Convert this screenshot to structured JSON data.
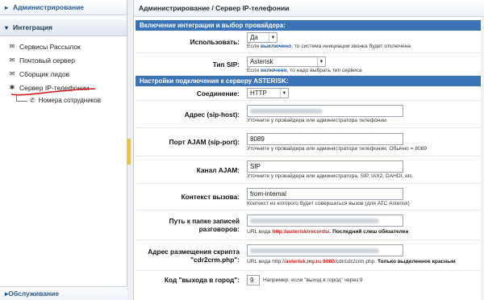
{
  "sidebar": {
    "admin_title": "Администрирование",
    "integration_title": "Интеграция",
    "items": [
      {
        "label": "Сервисы Рассылок",
        "icon": "envelope-icon"
      },
      {
        "label": "Почтовый сервер",
        "icon": "envelope-icon"
      },
      {
        "label": "Сборщик лидов",
        "icon": "envelope-icon"
      },
      {
        "label": "Сервер IP-телефонии",
        "icon": "gear-icon"
      }
    ],
    "sub_item": {
      "label": "Номера сотрудников",
      "icon": "phone-icon"
    },
    "footer": "Обслуживание"
  },
  "main": {
    "breadcrumb": "Администрирование / Сервер IP-телефонии",
    "section1": {
      "title": "Включение интеграции и выбор провайдера:",
      "use_label": "Использовать:",
      "use_value": "Да",
      "use_hint_pre": "Если ",
      "use_hint_kw": "выключено",
      "use_hint_post": ", то система инициации звонка будет отключена",
      "sip_label": "Тип SIP:",
      "sip_value": "Asterisk",
      "sip_hint_pre": "Если ",
      "sip_hint_kw": "включено",
      "sip_hint_post": ", то надо выбрать тип сервиса"
    },
    "section2": {
      "title": "Настройки подключения к серверу ASTERISK:",
      "conn_label": "Соединение:",
      "conn_value": "HTTP",
      "host_label": "Адрес (sip-host):",
      "host_hint": "Уточните у провайдера или администратора телефонии.",
      "port_label": "Порт AJAM (sip-port):",
      "port_value": "8089",
      "port_hint": "Уточните у провайдера или администратора телефонии. Обычно = 8089",
      "channel_label": "Канал AJAM:",
      "channel_value": "SIP",
      "channel_hint": "Уточните у провайдера или администратора. SIP, IAX2, DAHDI, etc.",
      "context_label": "Контекст вызова:",
      "context_value": "from-internal",
      "context_hint": "Контекст из которого будет совершаться вызов (для АТС Asterisk)",
      "records_label": "Путь к папке записей разговоров:",
      "records_hint_pre": "URL вида ",
      "records_hint_kw": "http://asterisk/records/",
      "records_hint_post": ". Последний слеш обязателен",
      "script_label": "Адрес размещения скрипта \"cdr2crm.php\":",
      "script_hint_pre": "URL вида http://",
      "script_hint_kw": "asterisk.my.ru:8080",
      "script_hint_mid": "/cdr/cdr2crm.php. ",
      "script_hint_post": "Только выделенное красным",
      "code_label": "Код \"выхода в город\":",
      "code_value": "9",
      "code_hint": "Например: если \"выход в город\" через 9"
    }
  },
  "colors": {
    "section_bg": "#3b73b6",
    "accent_red": "#c62020",
    "link_blue": "#1f55a8",
    "grip": "#f3c034"
  }
}
